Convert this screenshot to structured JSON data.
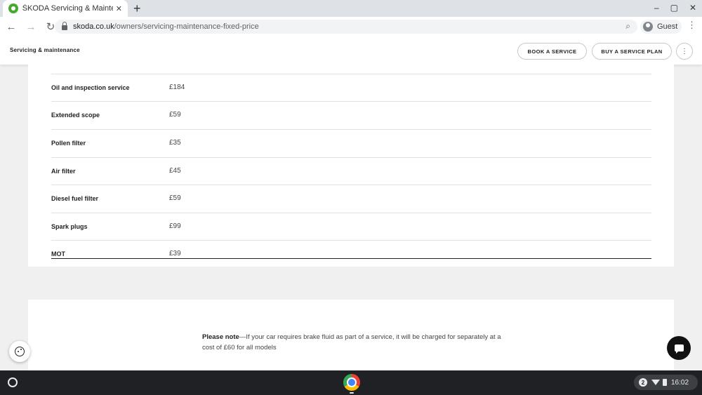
{
  "browser": {
    "tab_title": "ŠKODA Servicing & Maintenance",
    "tab_close": "✕",
    "new_tab": "+",
    "url_host": "skoda.co.uk",
    "url_path": "/owners/servicing-maintenance-fixed-price",
    "profile_label": "Guest",
    "window_controls": [
      "–",
      "▢",
      "✕"
    ]
  },
  "site_header": {
    "title": "Servicing & maintenance",
    "book_service": "BOOK A SERVICE",
    "buy_plan": "BUY A SERVICE PLAN"
  },
  "price_table": {
    "rows": [
      {
        "label": "Oil and inspection service",
        "price": "£184"
      },
      {
        "label": "Extended scope",
        "price": "£59"
      },
      {
        "label": "Pollen filter",
        "price": "£35"
      },
      {
        "label": "Air filter",
        "price": "£45"
      },
      {
        "label": "Diesel fuel filter",
        "price": "£59"
      },
      {
        "label": "Spark plugs",
        "price": "£99"
      },
      {
        "label": "MOT",
        "price": "£39"
      }
    ]
  },
  "note": {
    "bold": "Please note",
    "text": "—If your car requires brake fluid as part of a service, it will be charged for separately at a cost of £60 for all models"
  },
  "shelf": {
    "notification_count": "2",
    "time": "16:02"
  },
  "icons": [
    "skoda-favicon",
    "back-arrow-icon",
    "forward-arrow-icon",
    "reload-icon",
    "lock-icon",
    "search-icon",
    "guest-avatar-icon",
    "more-vert-icon",
    "cookie-icon",
    "chat-icon",
    "launcher-icon",
    "chrome-icon",
    "wifi-icon",
    "battery-icon"
  ],
  "colors": {
    "brand_green": "#4ba82e",
    "shelf": "#202124"
  }
}
